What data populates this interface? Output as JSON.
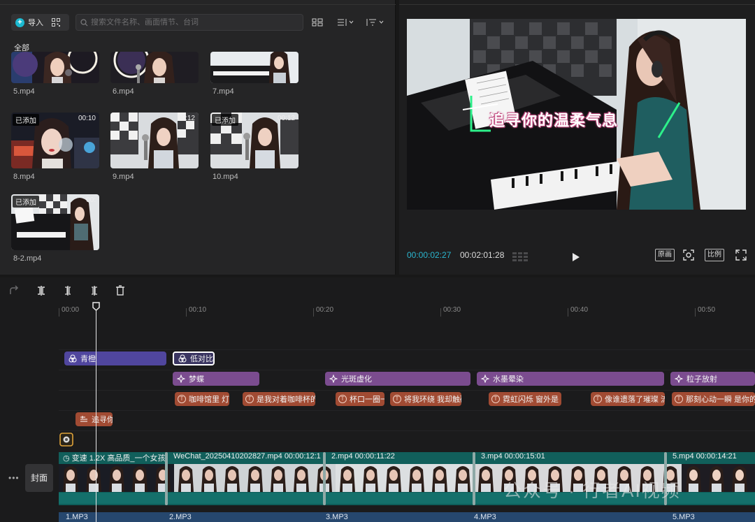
{
  "media": {
    "import_label": "导入",
    "search_placeholder": "搜索文件名称、画面情节、台词",
    "all_label": "全部",
    "clips": [
      {
        "name": "5.mp4",
        "added": "",
        "duration": ""
      },
      {
        "name": "6.mp4",
        "added": "",
        "duration": ""
      },
      {
        "name": "7.mp4",
        "added": "",
        "duration": ""
      },
      {
        "name": "8.mp4",
        "added": "已添加",
        "duration": "00:10"
      },
      {
        "name": "9.mp4",
        "added": "",
        "duration": "00:12"
      },
      {
        "name": "10.mp4",
        "added": "已添加",
        "duration": "00:12"
      },
      {
        "name": "8-2.mp4",
        "added": "已添加",
        "duration": "00:"
      }
    ]
  },
  "player": {
    "overlay_text": "追寻你的温柔气息",
    "time_current": "00:00:02:27",
    "time_total": "00:02:01:28",
    "original_label": "原画",
    "ratio_label": "比例"
  },
  "timeline": {
    "ruler": [
      "00:00",
      "00:10",
      "00:20",
      "00:30",
      "00:40",
      "00:50"
    ],
    "filters": [
      {
        "label": "青橙"
      },
      {
        "label": "低对比"
      }
    ],
    "effects": [
      {
        "label": "梦蝶"
      },
      {
        "label": "光斑虚化"
      },
      {
        "label": "水墨晕染"
      },
      {
        "label": "粒子放射"
      }
    ],
    "texts": [
      {
        "label": "咖啡馆里 灯"
      },
      {
        "label": "是我对着咖啡杯的"
      },
      {
        "label": "杯口一圈一"
      },
      {
        "label": "将我环绕 我却触碰"
      },
      {
        "label": "霓虹闪烁 窗外是"
      },
      {
        "label": "像谁遗落了璀璨 流"
      },
      {
        "label": "那刻心动一瞬 是你的"
      }
    ],
    "title_seg": "追寻你",
    "main_clips": [
      {
        "label": "变速 1.2X  高品质_一个女孩"
      },
      {
        "label": "WeChat_20250410202827.mp4   00:00:12:1"
      },
      {
        "label": "2.mp4   00:00:11:22"
      },
      {
        "label": "3.mp4   00:00:15:01"
      },
      {
        "label": "5.mp4   00:00:14:21"
      }
    ],
    "cover_label": "封面",
    "audio": [
      "1.MP3",
      "2.MP3",
      "3.MP3",
      "4.MP3",
      "5.MP3"
    ],
    "watermark": "公众号 · 行者AI视频"
  },
  "colors": {
    "accent": "#1bb9d1",
    "filter": "#50469e",
    "effect": "#7b4c8f",
    "text": "#a14b33",
    "main": "#0e5e5a",
    "audio": "#26476e"
  }
}
